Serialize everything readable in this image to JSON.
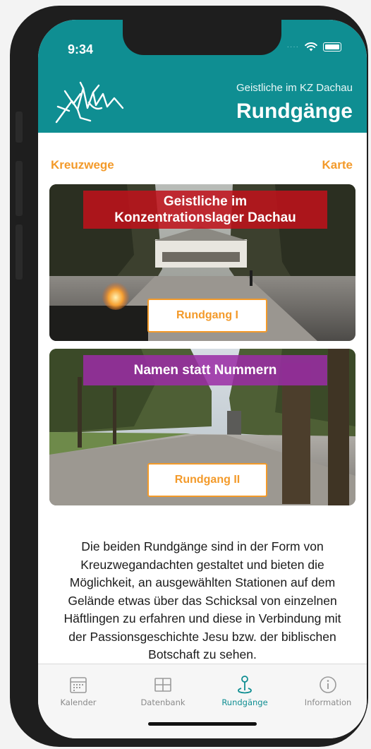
{
  "status": {
    "time": "9:34"
  },
  "header": {
    "subtitle": "Geistliche im KZ Dachau",
    "title": "Rundgänge"
  },
  "links": {
    "left": "Kreuzwege",
    "right": "Karte"
  },
  "cards": [
    {
      "title_line1": "Geistliche im",
      "title_line2": "Konzentrationslager Dachau",
      "button": "Rundgang I",
      "banner_color": "#c0111b"
    },
    {
      "title_line1": "Namen statt Nummern",
      "button": "Rundgang II",
      "banner_color": "#9b2ca5"
    }
  ],
  "description": "Die beiden Rundgänge sind in der Form von Kreuzwegandachten gestaltet und bieten die Möglichkeit, an ausgewählten Stationen auf dem Gelände etwas über das Schicksal von einzelnen Häftlingen zu erfahren und diese in Verbindung mit der Passionsgeschichte Jesu bzw. der biblischen Botschaft zu sehen.",
  "tabs": [
    {
      "label": "Kalender",
      "icon": "calendar-icon"
    },
    {
      "label": "Datenbank",
      "icon": "table-icon"
    },
    {
      "label": "Rundgänge",
      "icon": "map-pin-icon",
      "active": true
    },
    {
      "label": "Information",
      "icon": "info-icon"
    }
  ],
  "colors": {
    "accent": "#0f8e92",
    "link": "#f39a2a"
  }
}
